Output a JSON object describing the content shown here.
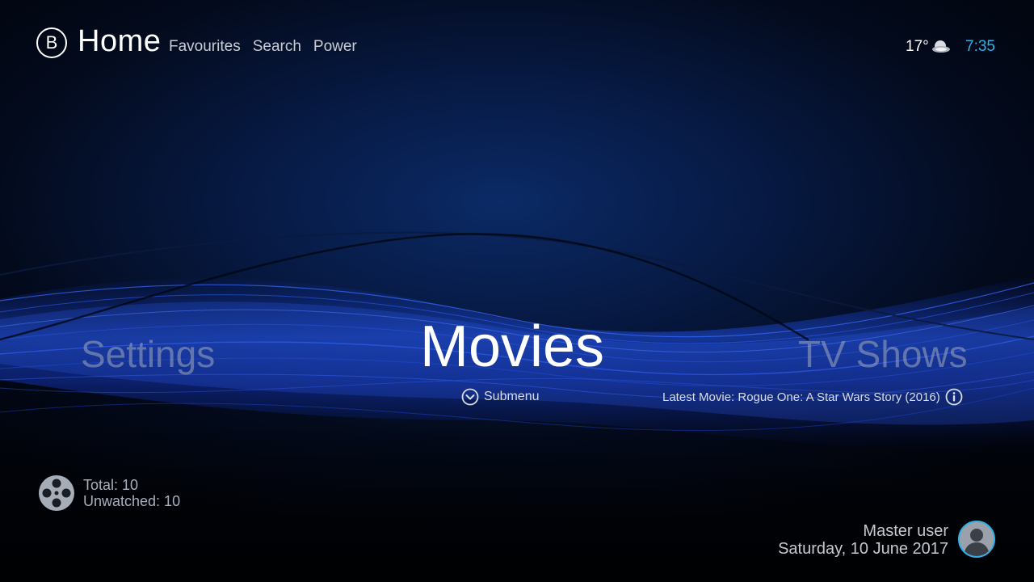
{
  "header": {
    "logo_letter": "B",
    "title": "Home",
    "nav": [
      "Favourites",
      "Search",
      "Power"
    ],
    "temperature": "17°",
    "weather_icon": "partly-cloudy-night-icon",
    "time": "7:35"
  },
  "main_menu": {
    "items": [
      {
        "label": "Settings",
        "state": "inactive"
      },
      {
        "label": "Movies",
        "state": "focused"
      },
      {
        "label": "TV Shows",
        "state": "inactive"
      }
    ],
    "submenu_label": "Submenu",
    "latest_info": "Latest Movie: Rogue One: A Star Wars Story (2016)"
  },
  "stats": {
    "icon": "film-reel-icon",
    "total": "Total: 10",
    "unwatched": "Unwatched: 10"
  },
  "footer": {
    "user": "Master user",
    "date": "Saturday, 10 June 2017"
  },
  "colors": {
    "accent": "#2fb0e6",
    "background": "#030a1c",
    "wave": "#1f4fe0"
  }
}
